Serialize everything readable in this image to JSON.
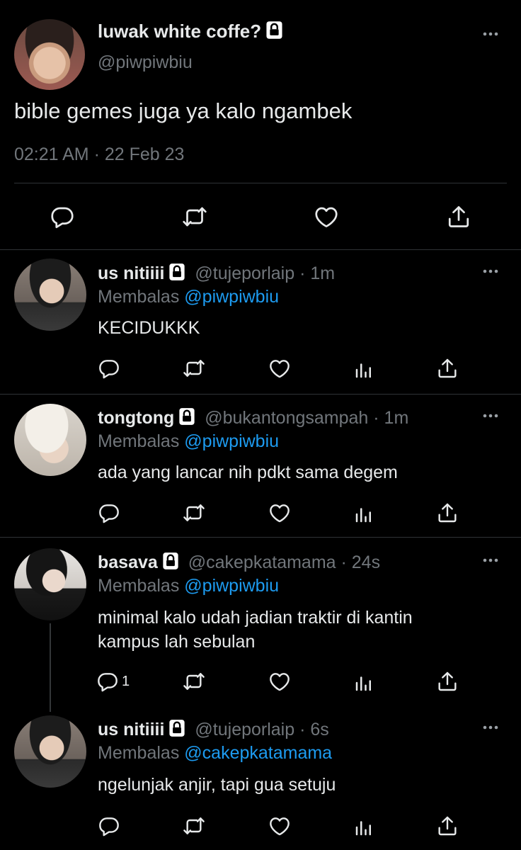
{
  "main_tweet": {
    "display_name": "luwak white coffe?",
    "handle": "@piwpiwbiu",
    "text": "bible gemes juga ya kalo ngambek",
    "timestamp": "02:21 AM · 22 Feb 23"
  },
  "replies": [
    {
      "display_name": "us nitiiii",
      "handle_time": "@tujeporlaip · 1m",
      "reply_prefix": "Membalas",
      "reply_to": "@piwpiwbiu",
      "text_lines": [
        "KECIDUKKK"
      ],
      "reply_count": ""
    },
    {
      "display_name": "tongtong",
      "handle_time": "@bukantongsampah · 1m",
      "reply_prefix": "Membalas",
      "reply_to": "@piwpiwbiu",
      "text_lines": [
        "ada yang lancar nih pdkt sama degem"
      ],
      "reply_count": ""
    },
    {
      "display_name": "basava",
      "handle_time": "@cakepkatamama · 24s",
      "reply_prefix": "Membalas",
      "reply_to": "@piwpiwbiu",
      "text_lines": [
        "minimal kalo udah jadian traktir di kantin",
        "kampus lah sebulan"
      ],
      "reply_count": "1"
    },
    {
      "display_name": "us nitiiii",
      "handle_time": "@tujeporlaip · 6s",
      "reply_prefix": "Membalas",
      "reply_to": "@cakepkatamama",
      "text_lines": [
        "ngelunjak anjir, tapi gua setuju"
      ],
      "reply_count": ""
    }
  ],
  "colors": {
    "background": "#000000",
    "text": "#e7e9ea",
    "muted": "#71767b",
    "link": "#1d9bf0",
    "divider": "#2f3336"
  },
  "icons": [
    "more-icon",
    "lock-icon",
    "reply-icon",
    "retweet-icon",
    "like-icon",
    "views-icon",
    "share-icon"
  ]
}
